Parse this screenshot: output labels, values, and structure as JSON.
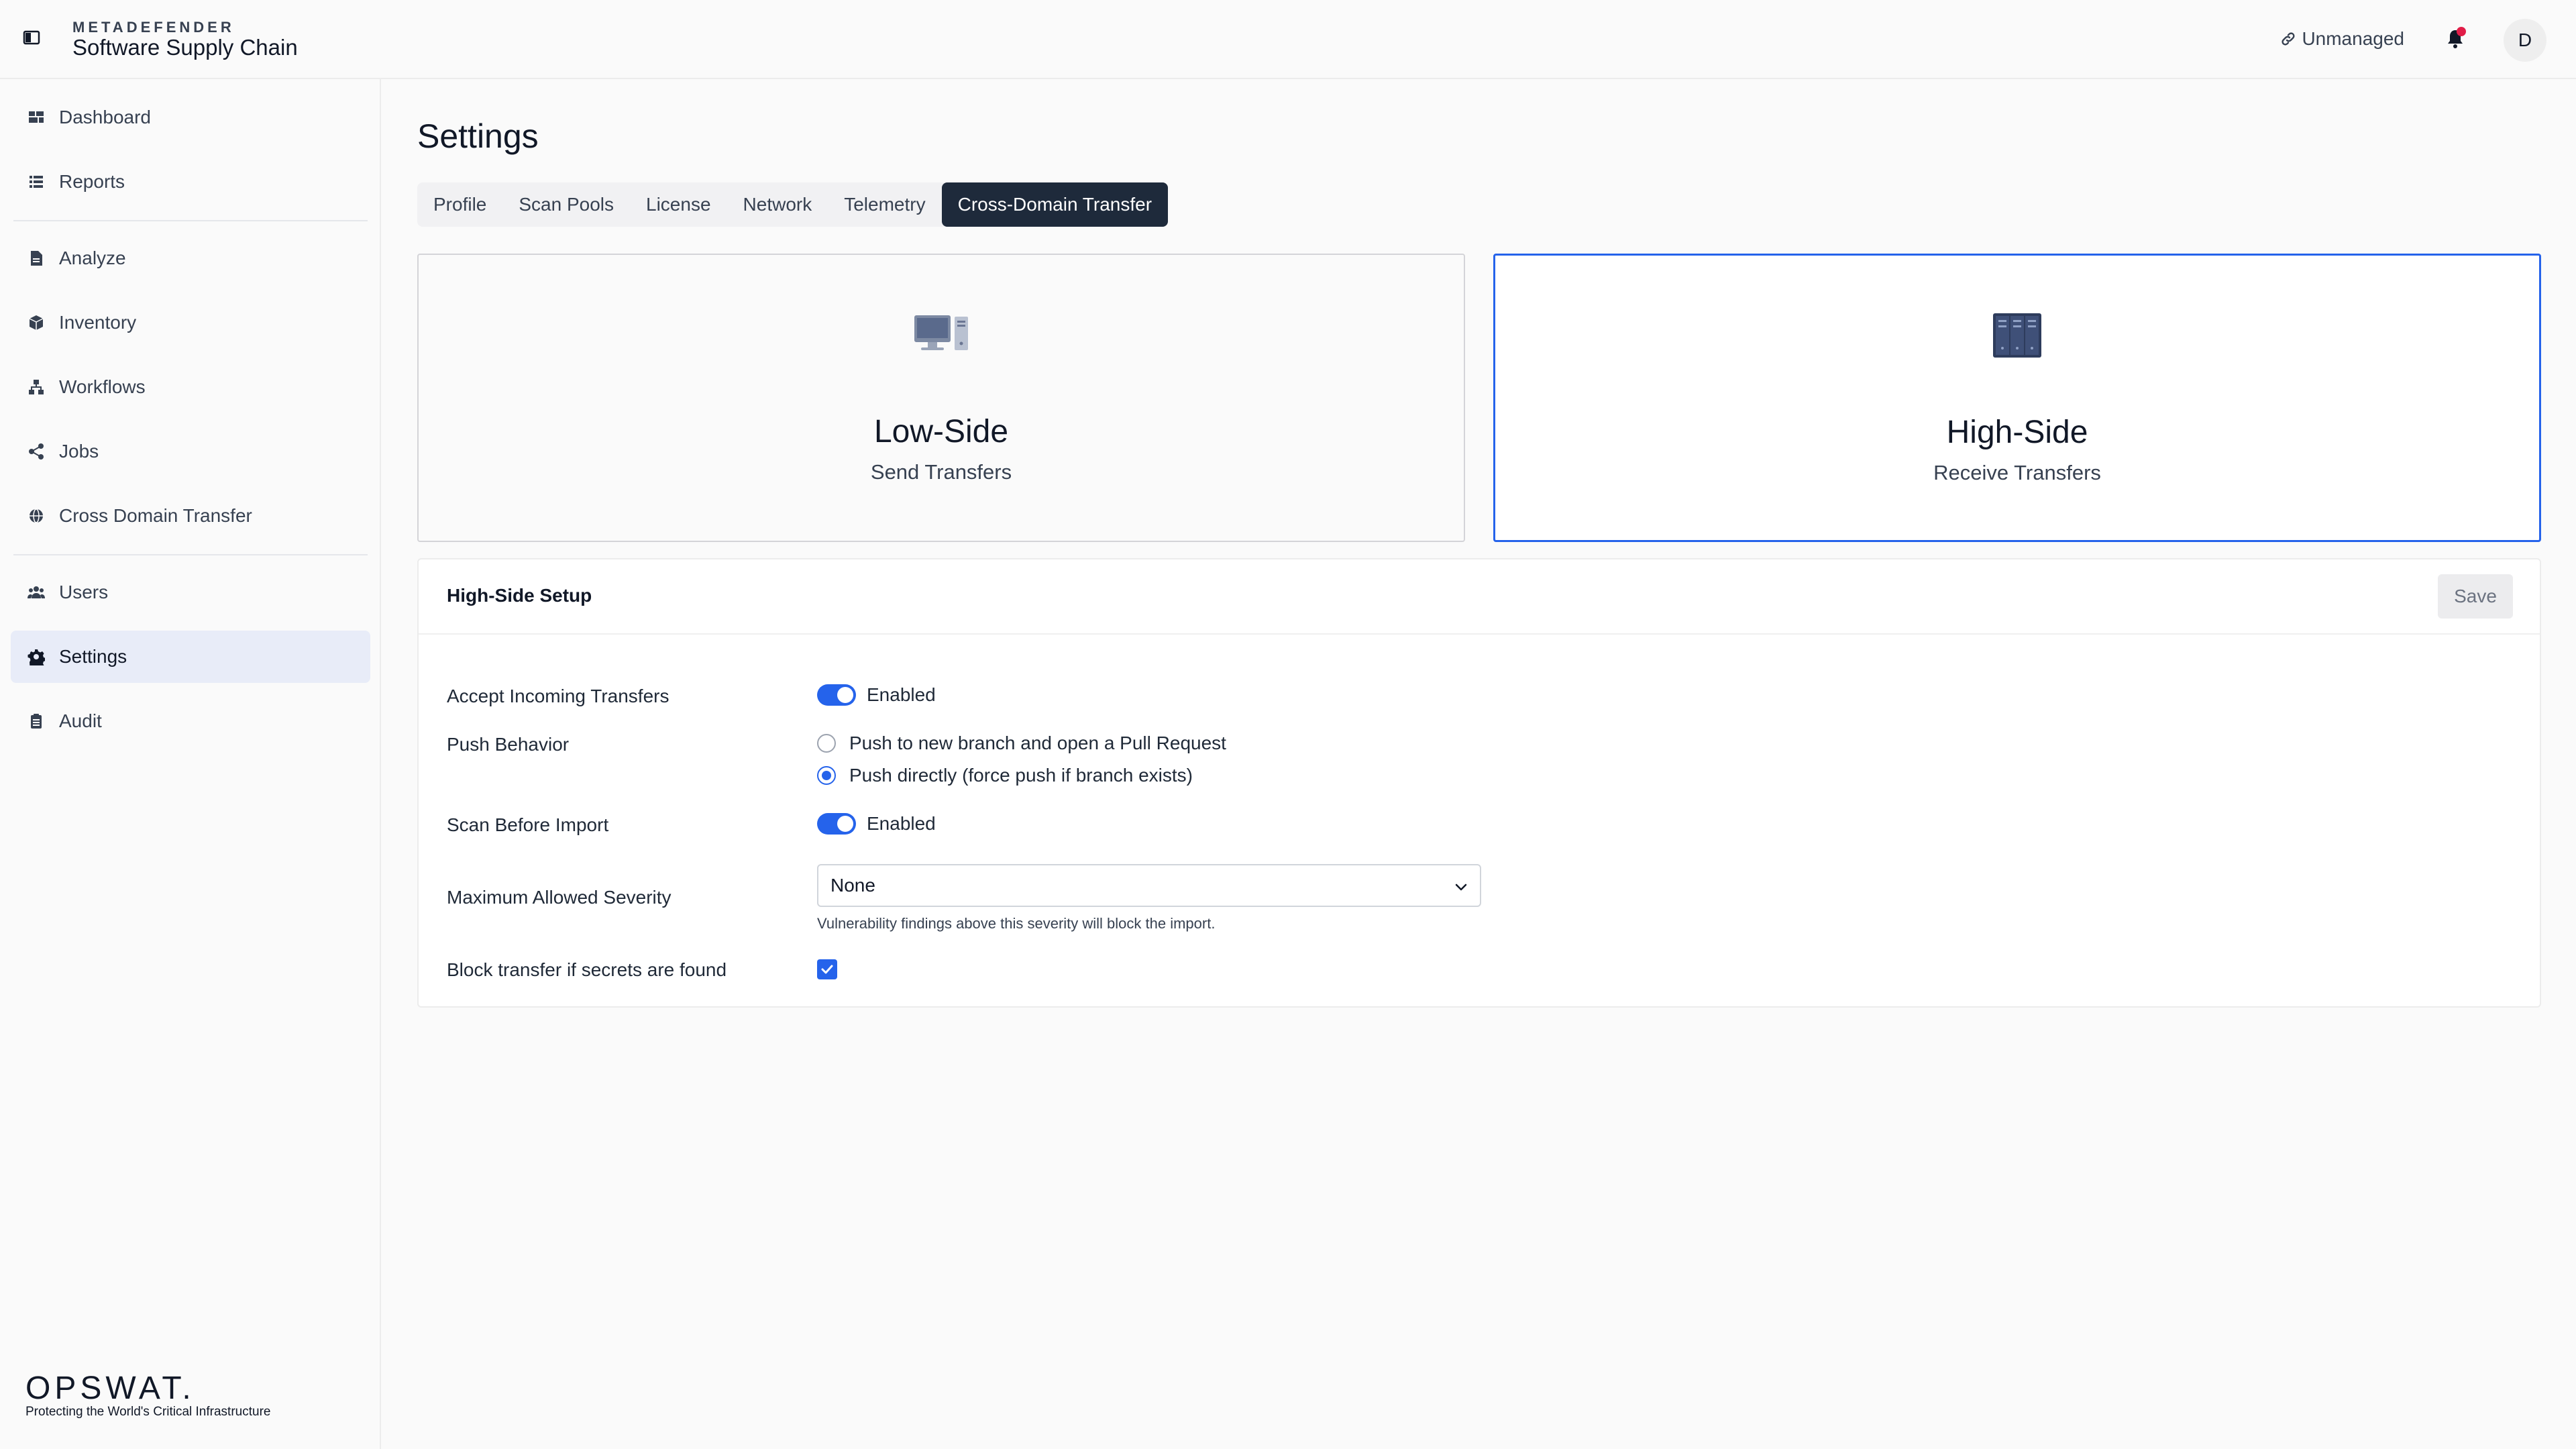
{
  "header": {
    "brand_small": "METADEFENDER",
    "brand_title": "Software Supply Chain",
    "unmanaged_label": "Unmanaged",
    "avatar_initial": "D"
  },
  "sidebar": {
    "items": [
      {
        "label": "Dashboard",
        "icon": "dashboard-icon"
      },
      {
        "label": "Reports",
        "icon": "list-icon"
      },
      {
        "label": "Analyze",
        "icon": "file-icon"
      },
      {
        "label": "Inventory",
        "icon": "cube-icon"
      },
      {
        "label": "Workflows",
        "icon": "sitemap-icon"
      },
      {
        "label": "Jobs",
        "icon": "share-icon"
      },
      {
        "label": "Cross Domain Transfer",
        "icon": "globe-icon"
      },
      {
        "label": "Users",
        "icon": "users-icon"
      },
      {
        "label": "Settings",
        "icon": "gear-icon",
        "active": true
      },
      {
        "label": "Audit",
        "icon": "clipboard-icon"
      }
    ],
    "logo_text": "OPSWAT.",
    "logo_tagline": "Protecting the World's Critical Infrastructure"
  },
  "main": {
    "title": "Settings",
    "tabs": [
      {
        "label": "Profile"
      },
      {
        "label": "Scan Pools"
      },
      {
        "label": "License"
      },
      {
        "label": "Network"
      },
      {
        "label": "Telemetry"
      },
      {
        "label": "Cross-Domain Transfer",
        "active": true
      }
    ],
    "side_cards": [
      {
        "title": "Low-Side",
        "subtitle": "Send Transfers",
        "icon": "desktop-computer-icon",
        "selected": false
      },
      {
        "title": "High-Side",
        "subtitle": "Receive Transfers",
        "icon": "server-rack-icon",
        "selected": true
      }
    ],
    "setup": {
      "title": "High-Side Setup",
      "save_label": "Save",
      "accept_label": "Accept Incoming Transfers",
      "accept_value": "Enabled",
      "push_label": "Push Behavior",
      "push_options": [
        {
          "label": "Push to new branch and open a Pull Request",
          "selected": false
        },
        {
          "label": "Push directly (force push if branch exists)",
          "selected": true
        }
      ],
      "scan_label": "Scan Before Import",
      "scan_value": "Enabled",
      "severity_label": "Maximum Allowed Severity",
      "severity_value": "None",
      "severity_hint": "Vulnerability findings above this severity will block the import.",
      "secrets_label": "Block transfer if secrets are found",
      "secrets_checked": true
    }
  },
  "colors": {
    "accent": "#2563eb",
    "active_tab": "#1e2a3b",
    "active_nav_bg": "#e8ecf8",
    "notification_dot": "#e11d48"
  }
}
